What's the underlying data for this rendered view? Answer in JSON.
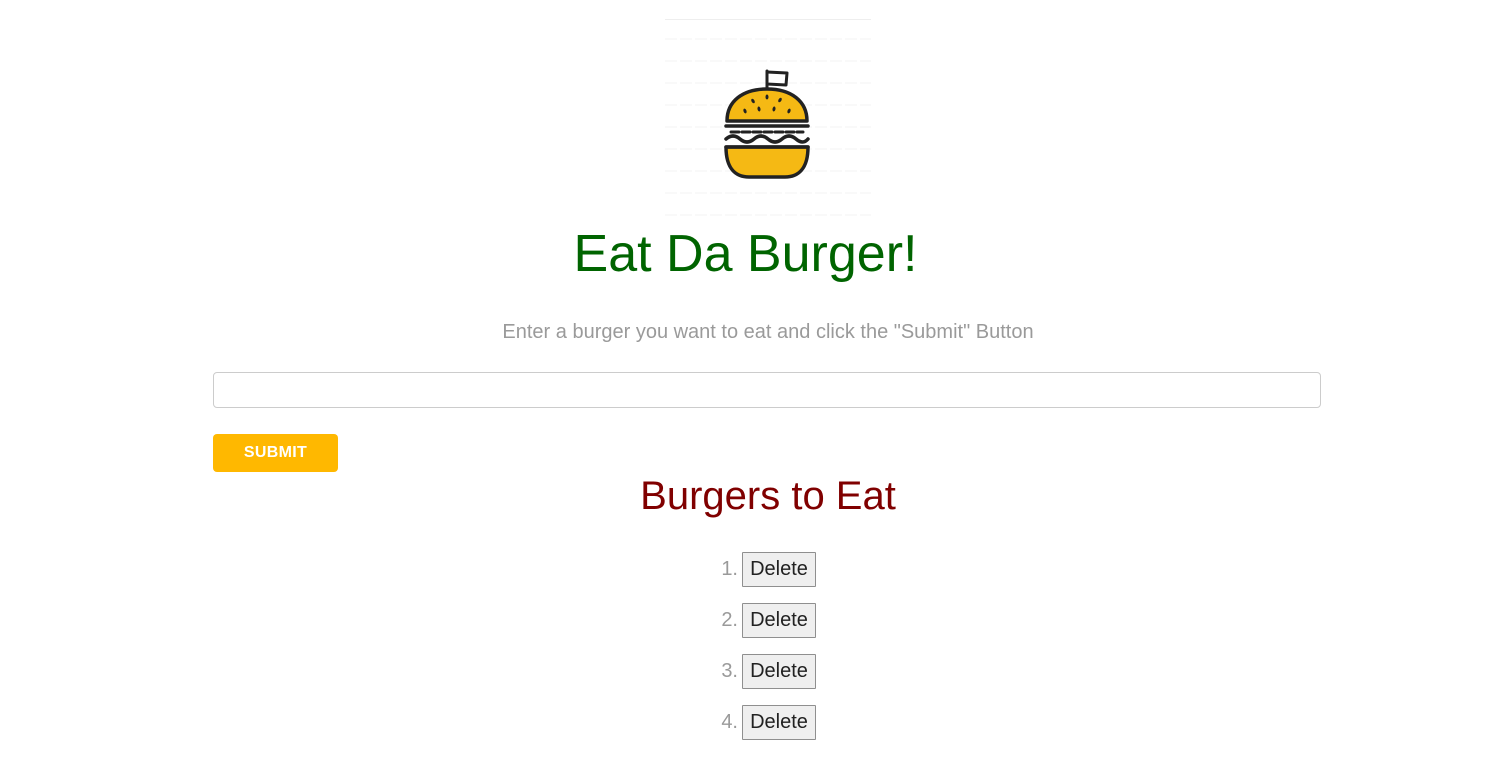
{
  "header": {
    "title": "Eat Da Burger!",
    "subtitle": "Enter a burger you want to eat and click the \"Submit\" Button"
  },
  "form": {
    "input_value": "",
    "input_placeholder": "",
    "submit_label": "SUBMIT"
  },
  "list": {
    "title": "Burgers to Eat",
    "items": [
      {
        "number": "1.",
        "name": "",
        "button_label": "Delete"
      },
      {
        "number": "2.",
        "name": "",
        "button_label": "Delete"
      },
      {
        "number": "3.",
        "name": "",
        "button_label": "Delete"
      },
      {
        "number": "4.",
        "name": "",
        "button_label": "Delete"
      }
    ]
  },
  "icons": {
    "logo": "burger-icon"
  },
  "colors": {
    "title": "#006400",
    "subtitle": "#9a9a9a",
    "submit_bg": "#ffb800",
    "section_title": "#800000",
    "burger_yellow": "#f5b914",
    "outline": "#222222"
  }
}
